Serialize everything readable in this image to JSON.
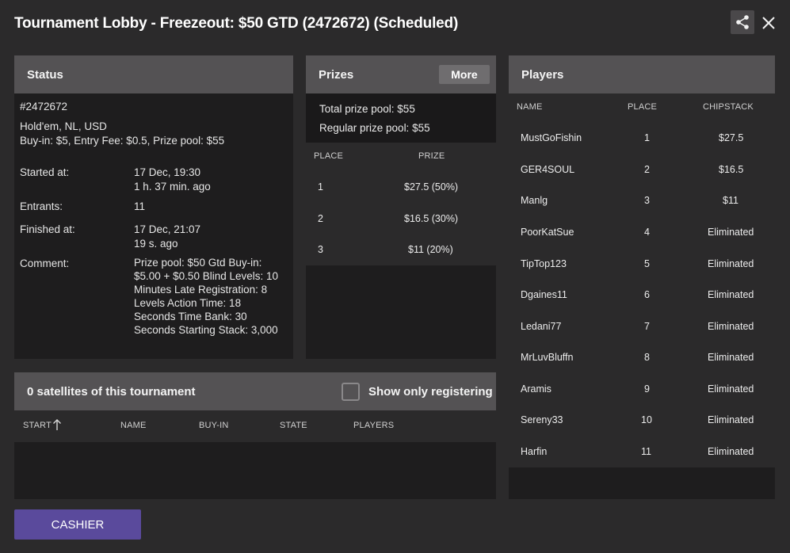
{
  "window": {
    "title": "Tournament Lobby - Freezeout: $50 GTD (2472672) (Scheduled)",
    "share_icon": "share-icon",
    "close_icon": "close-icon"
  },
  "status": {
    "header": "Status",
    "id": "#2472672",
    "game": "Hold'em, NL, USD",
    "buyin_line": "Buy-in: $5, Entry Fee: $0.5, Prize pool: $55",
    "started_label": "Started at:",
    "started_value": "17 Dec, 19:30",
    "started_ago": "1 h. 37 min. ago",
    "entrants_label": "Entrants:",
    "entrants_value": "11",
    "finished_label": "Finished at:",
    "finished_value": "17 Dec, 21:07",
    "finished_ago": "19 s. ago",
    "comment_label": "Comment:",
    "comment_lines": [
      "Prize pool: $50 Gtd Buy-in:",
      "$5.00 + $0.50 Blind Levels: 10",
      "Minutes Late Registration: 8",
      "Levels Action Time: 18",
      "Seconds Time Bank: 30",
      "Seconds Starting Stack: 3,000"
    ]
  },
  "prizes": {
    "header": "Prizes",
    "more_label": "More",
    "total_pool": "Total prize pool: $55",
    "regular_pool": "Regular prize pool: $55",
    "col_place": "PLACE",
    "col_prize": "PRIZE",
    "rows": [
      {
        "place": "1",
        "prize": "$27.5 (50%)"
      },
      {
        "place": "2",
        "prize": "$16.5 (30%)"
      },
      {
        "place": "3",
        "prize": "$11 (20%)"
      }
    ]
  },
  "players": {
    "header": "Players",
    "col_name": "NAME",
    "col_place": "PLACE",
    "col_chipstack": "CHIPSTACK",
    "rows": [
      {
        "name": "MustGoFishin",
        "place": "1",
        "chips": "$27.5"
      },
      {
        "name": "GER4SOUL",
        "place": "2",
        "chips": "$16.5"
      },
      {
        "name": "Manlg",
        "place": "3",
        "chips": "$11"
      },
      {
        "name": "PoorKatSue",
        "place": "4",
        "chips": "Eliminated"
      },
      {
        "name": "TipTop123",
        "place": "5",
        "chips": "Eliminated"
      },
      {
        "name": "Dgaines11",
        "place": "6",
        "chips": "Eliminated"
      },
      {
        "name": "Ledani77",
        "place": "7",
        "chips": "Eliminated"
      },
      {
        "name": "MrLuvBluffn",
        "place": "8",
        "chips": "Eliminated"
      },
      {
        "name": "Aramis",
        "place": "9",
        "chips": "Eliminated"
      },
      {
        "name": "Sereny33",
        "place": "10",
        "chips": "Eliminated"
      },
      {
        "name": "Harfin",
        "place": "11",
        "chips": "Eliminated"
      }
    ]
  },
  "satellites": {
    "header": "0 satellites of this tournament",
    "checkbox_label": "Show only registering",
    "checkbox_checked": false,
    "col_start": "START",
    "col_name": "NAME",
    "col_buyin": "BUY-IN",
    "col_state": "STATE",
    "col_players": "PLAYERS",
    "sort_icon": "arrow-up-icon"
  },
  "footer": {
    "cashier_label": "CASHIER"
  },
  "colors": {
    "background": "#2b2a2b",
    "panel_header": "#545254",
    "panel_body": "#1e1d1e",
    "accent_button": "#5a4a9c"
  }
}
